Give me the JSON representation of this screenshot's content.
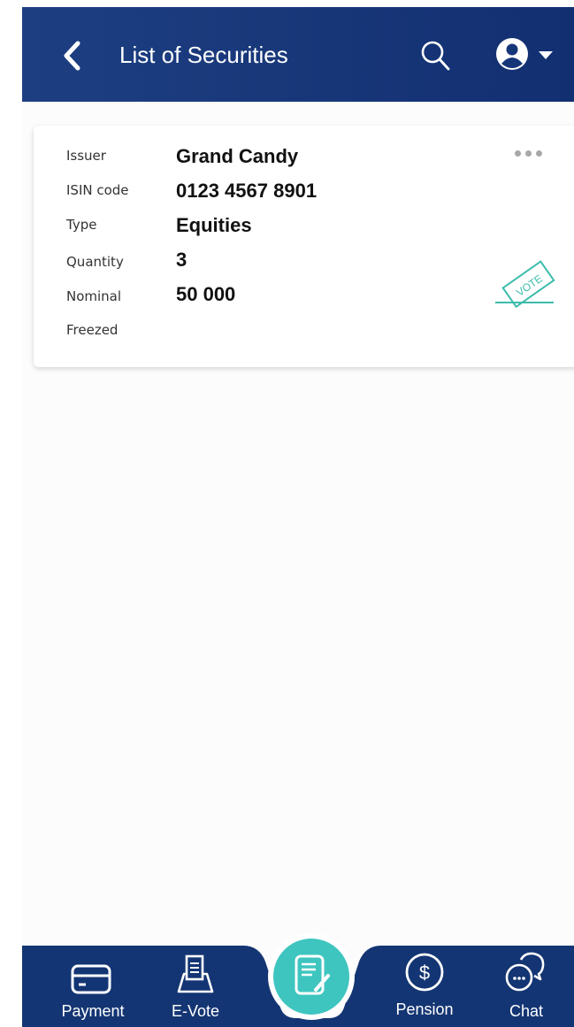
{
  "header": {
    "title": "List of Securities"
  },
  "security": {
    "fields": [
      {
        "label": "Issuer",
        "value": "Grand Candy"
      },
      {
        "label": "ISIN code",
        "value": "0123 4567 8901"
      },
      {
        "label": "Type",
        "value": "Equities"
      },
      {
        "label": "Quantity",
        "value": "3"
      },
      {
        "label": "Nominal",
        "value": "50 000"
      },
      {
        "label": "Freezed",
        "value": ""
      }
    ],
    "vote_badge": "VOTE"
  },
  "nav": {
    "items": [
      {
        "label": "Payment",
        "icon": "card-icon"
      },
      {
        "label": "E-Vote",
        "icon": "ballot-box-icon"
      },
      {
        "label": "",
        "icon": "securities-document-icon"
      },
      {
        "label": "Pension",
        "icon": "dollar-coin-icon"
      },
      {
        "label": "Chat",
        "icon": "chat-bubbles-icon"
      }
    ]
  },
  "colors": {
    "header_bg": "#1d3f82",
    "nav_bg": "#143573",
    "accent_teal": "#3ec5bf",
    "vote_green": "#3cbcab"
  }
}
